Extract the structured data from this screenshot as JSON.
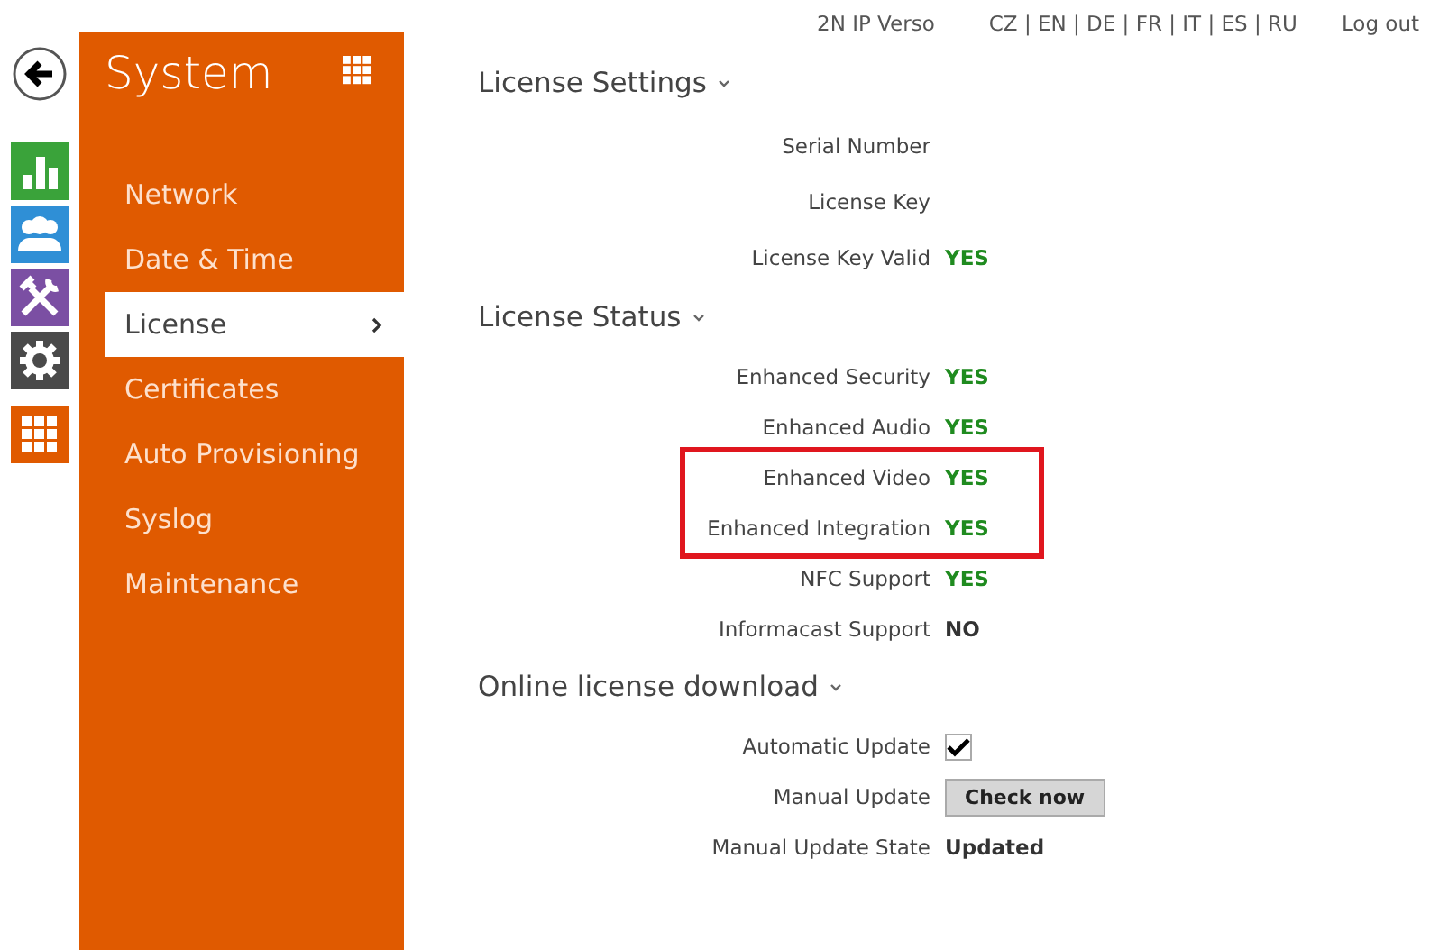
{
  "header": {
    "device": "2N IP Verso",
    "languages": "CZ | EN | DE | FR | IT | ES | RU",
    "logout": "Log out"
  },
  "rail": [
    {
      "kind": "stats"
    },
    {
      "kind": "users"
    },
    {
      "kind": "tools"
    },
    {
      "kind": "gear"
    },
    {
      "kind": "grid"
    }
  ],
  "sidebar": {
    "title": "System",
    "items": [
      {
        "label": "Network",
        "selected": false
      },
      {
        "label": "Date & Time",
        "selected": false
      },
      {
        "label": "License",
        "selected": true
      },
      {
        "label": "Certificates",
        "selected": false
      },
      {
        "label": "Auto Provisioning",
        "selected": false
      },
      {
        "label": "Syslog",
        "selected": false
      },
      {
        "label": "Maintenance",
        "selected": false
      }
    ]
  },
  "sections": [
    {
      "title": "License Settings",
      "rows": [
        {
          "label": "Serial Number",
          "kind": "empty",
          "highlighted": false
        },
        {
          "label": "License Key",
          "kind": "empty",
          "highlighted": false
        },
        {
          "label": "License Key Valid",
          "kind": "status",
          "value": "YES",
          "positive": true,
          "highlighted": false
        }
      ]
    },
    {
      "title": "License Status",
      "rows": [
        {
          "label": "Enhanced Security",
          "kind": "status",
          "value": "YES",
          "positive": true,
          "highlighted": false
        },
        {
          "label": "Enhanced Audio",
          "kind": "status",
          "value": "YES",
          "positive": true,
          "highlighted": false
        },
        {
          "label": "Enhanced Video",
          "kind": "status",
          "value": "YES",
          "positive": true,
          "highlighted": true
        },
        {
          "label": "Enhanced Integration",
          "kind": "status",
          "value": "YES",
          "positive": true,
          "highlighted": true
        },
        {
          "label": "NFC Support",
          "kind": "status",
          "value": "YES",
          "positive": true,
          "highlighted": false
        },
        {
          "label": "Informacast Support",
          "kind": "status",
          "value": "NO",
          "positive": false,
          "highlighted": false
        }
      ]
    },
    {
      "title": "Online license download",
      "rows": [
        {
          "label": "Automatic Update",
          "kind": "checkbox",
          "checked": true,
          "highlighted": false
        },
        {
          "label": "Manual Update",
          "kind": "button",
          "value": "Check now",
          "highlighted": false
        },
        {
          "label": "Manual Update State",
          "kind": "bold",
          "value": "Updated",
          "highlighted": false
        }
      ]
    }
  ]
}
